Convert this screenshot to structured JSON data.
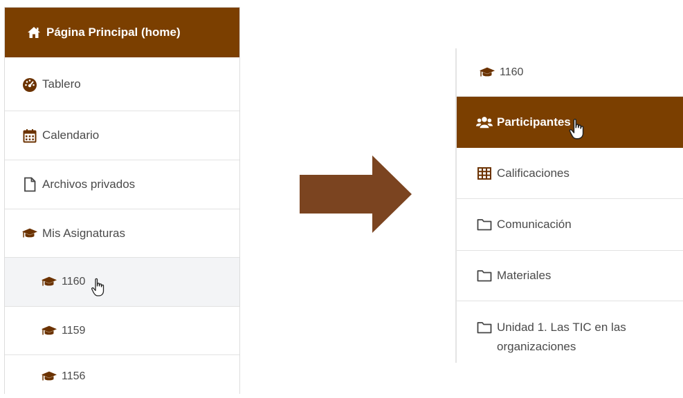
{
  "left_menu": {
    "home": {
      "label": "Página Principal (home)",
      "icon": "home-icon"
    },
    "items": [
      {
        "label": "Tablero",
        "icon": "dashboard-icon"
      },
      {
        "label": "Calendario",
        "icon": "calendar-icon"
      },
      {
        "label": "Archivos privados",
        "icon": "file-icon"
      },
      {
        "label": "Mis Asignaturas",
        "icon": "graduation-cap-icon"
      }
    ],
    "courses": [
      {
        "label": "1160",
        "icon": "graduation-cap-icon"
      },
      {
        "label": "1159",
        "icon": "graduation-cap-icon"
      },
      {
        "label": "1156",
        "icon": "graduation-cap-icon"
      }
    ]
  },
  "right_menu": {
    "course": {
      "label": "1160",
      "icon": "graduation-cap-icon"
    },
    "items": [
      {
        "label": "Participantes",
        "icon": "users-icon"
      },
      {
        "label": "Calificaciones",
        "icon": "table-icon"
      },
      {
        "label": "Comunicación",
        "icon": "folder-icon"
      },
      {
        "label": "Materiales",
        "icon": "folder-icon"
      },
      {
        "label": "Unidad 1. Las TIC en las organizaciones",
        "icon": "folder-icon"
      }
    ]
  },
  "colors": {
    "accent": "#7b3f00",
    "arrow": "#7b4420",
    "icon": "#7a3e00"
  }
}
